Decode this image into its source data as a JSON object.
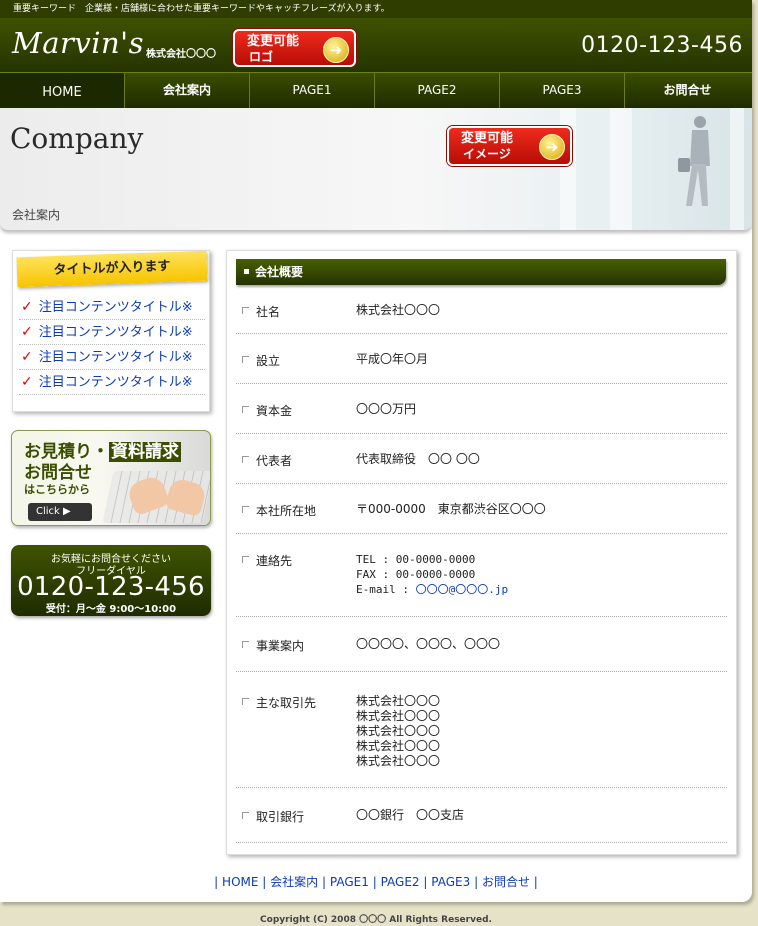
{
  "tagline": "重要キーワード　企業様・店舗様に合わせた重要キーワードやキャッチフレーズが入ります。",
  "header": {
    "logo_text": "Marvin's",
    "company": "株式会社〇〇〇",
    "logo_badge": {
      "line1": "変更可能",
      "line2": "ロゴ"
    },
    "phone": "0120-123-456"
  },
  "nav": {
    "items": [
      {
        "label": "HOME"
      },
      {
        "label": "会社案内"
      },
      {
        "label": "PAGE1"
      },
      {
        "label": "PAGE2"
      },
      {
        "label": "PAGE3"
      },
      {
        "label": "お問合せ"
      }
    ]
  },
  "hero": {
    "title": "Company",
    "subtitle": "会社案内",
    "image_badge": {
      "line1": "変更可能",
      "line2": "イメージ"
    }
  },
  "sidebar": {
    "box_title": "タイトルが入ります",
    "items": [
      {
        "label": "注目コンテンツタイトル※"
      },
      {
        "label": "注目コンテンツタイトル※"
      },
      {
        "label": "注目コンテンツタイトル※"
      },
      {
        "label": "注目コンテンツタイトル※"
      }
    ],
    "estimate": {
      "line1a": "お見積り・",
      "line1b": "資料請求",
      "line2": "お問合せ",
      "line3": "はこちらから",
      "click": "Click ▶"
    },
    "call": {
      "line1": "お気軽にお問合せください",
      "line2": "フリーダイヤル",
      "number": "0120-123-456",
      "hours": "受付：月〜金 9:00〜10:00"
    }
  },
  "main": {
    "heading": "会社概要",
    "rows": [
      {
        "label": "社名",
        "values": [
          "株式会社〇〇〇"
        ]
      },
      {
        "label": "設立",
        "values": [
          "平成〇年〇月"
        ]
      },
      {
        "label": "資本金",
        "values": [
          "〇〇〇万円"
        ]
      },
      {
        "label": "代表者",
        "values": [
          "代表取締役　〇〇 〇〇"
        ]
      },
      {
        "label": "本社所在地",
        "values": [
          "〒000-0000　東京都渋谷区〇〇〇"
        ]
      },
      {
        "label": "連絡先",
        "values": [
          "TEL : 00-0000-0000",
          "FAX : 00-0000-0000",
          "E-mail : "
        ],
        "email": "〇〇〇@〇〇〇.jp"
      },
      {
        "label": "事業案内",
        "values": [
          "〇〇〇〇、〇〇〇、〇〇〇"
        ]
      },
      {
        "label": "主な取引先",
        "values": [
          "株式会社〇〇〇",
          "株式会社〇〇〇",
          "株式会社〇〇〇",
          "株式会社〇〇〇",
          "株式会社〇〇〇"
        ]
      },
      {
        "label": "取引銀行",
        "values": [
          "〇〇銀行　〇〇支店"
        ]
      }
    ]
  },
  "footer": {
    "links": [
      {
        "label": "HOME"
      },
      {
        "label": "会社案内"
      },
      {
        "label": "PAGE1"
      },
      {
        "label": "PAGE2"
      },
      {
        "label": "PAGE3"
      },
      {
        "label": "お問合せ"
      }
    ],
    "copyright": "Copyright (C) 2008 〇〇〇 All Rights Reserved."
  }
}
